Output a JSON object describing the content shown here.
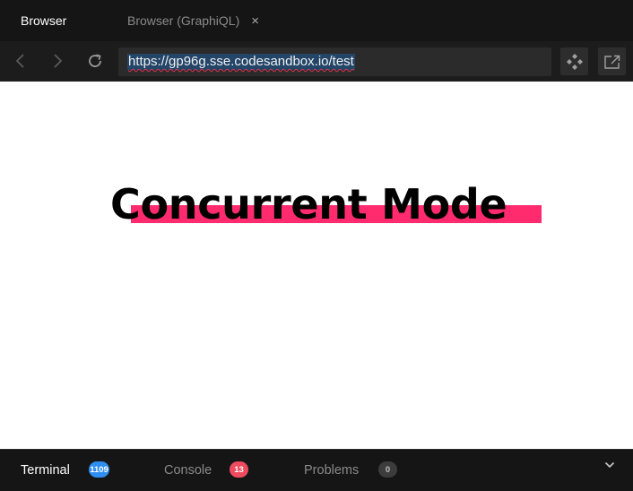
{
  "tabs": [
    {
      "label": "Browser"
    },
    {
      "label": "Browser (GraphiQL)",
      "close_icon": "×"
    }
  ],
  "navbar": {
    "url": "https://gp96g.sse.codesandbox.io/test",
    "icons": [
      "chevron-left-icon",
      "chevron-right-icon",
      "refresh-icon",
      "devtools-icon",
      "open-in-new-window-icon"
    ]
  },
  "preview": {
    "heading": "Concurrent Mode",
    "highlight_color": "#ff2b6e"
  },
  "bottom_panel": {
    "tabs": [
      {
        "label": "Terminal",
        "badge": "1109",
        "badge_color": "#2f8ef0"
      },
      {
        "label": "Console",
        "badge": "13",
        "badge_color": "#ef4b5f"
      },
      {
        "label": "Problems",
        "badge": "0",
        "badge_color": "#3c3c3c"
      }
    ],
    "collapse_icon": "chevron-down-icon"
  }
}
